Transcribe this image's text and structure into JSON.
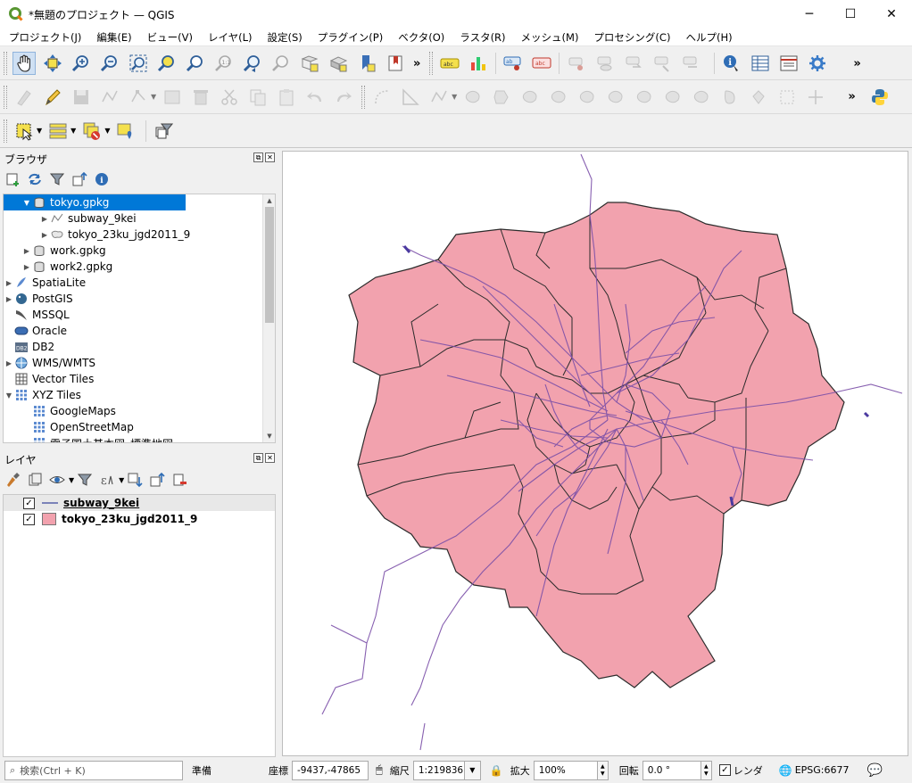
{
  "window": {
    "title": "*無題のプロジェクト — QGIS",
    "minimize": "─",
    "maximize": "☐",
    "close": "✕"
  },
  "menu": [
    "プロジェクト(J)",
    "編集(E)",
    "ビュー(V)",
    "レイヤ(L)",
    "設定(S)",
    "プラグイン(P)",
    "ベクタ(O)",
    "ラスタ(R)",
    "メッシュ(M)",
    "プロセシング(C)",
    "ヘルプ(H)"
  ],
  "toolbar": {
    "overflow": "»"
  },
  "browser": {
    "title": "ブラウザ",
    "items": [
      {
        "label": "tokyo.gpkg",
        "icon": "geopackage-icon",
        "level": 1,
        "arrow": "▼",
        "selected": true
      },
      {
        "label": "subway_9kei",
        "icon": "line-layer-icon",
        "level": 2,
        "arrow": "▶"
      },
      {
        "label": "tokyo_23ku_jgd2011_9",
        "icon": "polygon-layer-icon",
        "level": 2,
        "arrow": "▶"
      },
      {
        "label": "work.gpkg",
        "icon": "geopackage-icon",
        "level": 1,
        "arrow": "▶"
      },
      {
        "label": "work2.gpkg",
        "icon": "geopackage-icon",
        "level": 1,
        "arrow": "▶"
      },
      {
        "label": "SpatiaLite",
        "icon": "spatialite-icon",
        "level": 0,
        "arrow": "▶"
      },
      {
        "label": "PostGIS",
        "icon": "postgis-icon",
        "level": 0,
        "arrow": "▶"
      },
      {
        "label": "MSSQL",
        "icon": "mssql-icon",
        "level": 0,
        "arrow": ""
      },
      {
        "label": "Oracle",
        "icon": "oracle-icon",
        "level": 0,
        "arrow": ""
      },
      {
        "label": "DB2",
        "icon": "db2-icon",
        "level": 0,
        "arrow": ""
      },
      {
        "label": "WMS/WMTS",
        "icon": "wms-icon",
        "level": 0,
        "arrow": "▶"
      },
      {
        "label": "Vector Tiles",
        "icon": "vector-tiles-icon",
        "level": 0,
        "arrow": ""
      },
      {
        "label": "XYZ Tiles",
        "icon": "xyz-tiles-icon",
        "level": 0,
        "arrow": "▼"
      },
      {
        "label": "GoogleMaps",
        "icon": "xyz-tile-icon",
        "level": 1,
        "arrow": ""
      },
      {
        "label": "OpenStreetMap",
        "icon": "xyz-tile-icon",
        "level": 1,
        "arrow": ""
      },
      {
        "label": "電子国土基本図_標準地図",
        "icon": "xyz-tile-icon",
        "level": 1,
        "arrow": ""
      }
    ]
  },
  "layers": {
    "title": "レイヤ",
    "items": [
      {
        "label": "subway_9kei",
        "checked": "✓",
        "symbol": "line",
        "color": "#7b82b8"
      },
      {
        "label": "tokyo_23ku_jgd2011_9",
        "checked": "✓",
        "symbol": "fill",
        "color": "#f2a2ae"
      }
    ]
  },
  "map": {
    "fill_color": "#f2a2ae",
    "line_color": "#7b4fa8",
    "boundary_color": "#2b2b2b"
  },
  "status": {
    "search_placeholder": "検索(Ctrl + K)",
    "ready": "準備",
    "coord_label": "座標",
    "coord_value": "-9437,-47865",
    "scale_label": "縮尺",
    "scale_value": "1:219836",
    "magnifier_label": "拡大",
    "magnifier_value": "100%",
    "rotation_label": "回転",
    "rotation_value": "0.0 °",
    "render_label": "レンダ",
    "render_checked": "✓",
    "crs": "EPSG:6677"
  }
}
